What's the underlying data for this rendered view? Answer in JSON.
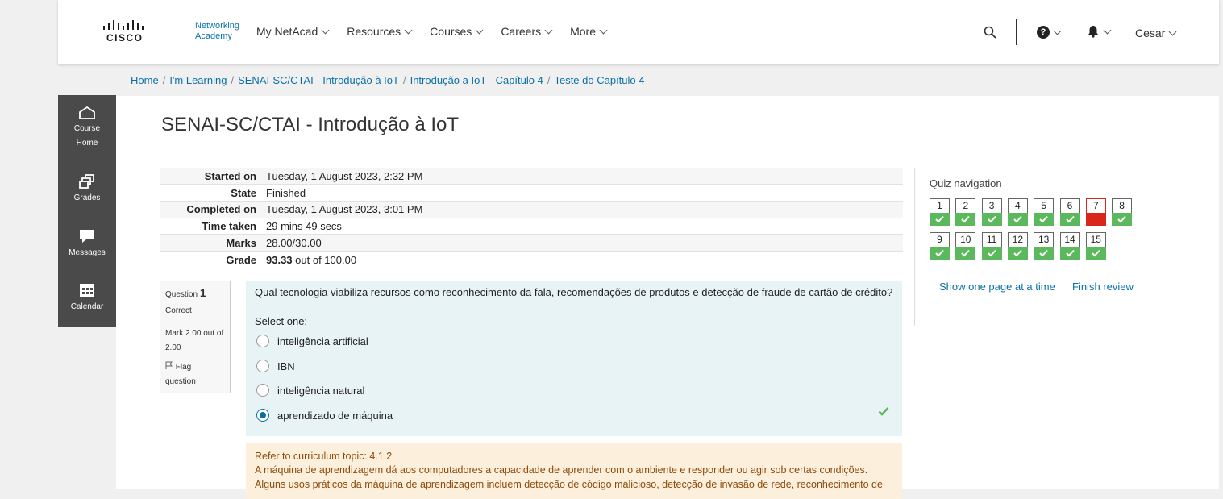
{
  "header": {
    "logo_word": "CISCO",
    "academy_line1": "Networking",
    "academy_line2": "Academy",
    "nav": [
      "My NetAcad",
      "Resources",
      "Courses",
      "Careers",
      "More"
    ],
    "help_glyph": "?",
    "user": "Cesar"
  },
  "breadcrumb": [
    "Home",
    "I'm Learning",
    "SENAI-SC/CTAI - Introdução à IoT",
    "Introdução a IoT - Capítulo 4",
    "Teste do Capítulo 4"
  ],
  "sidebar": [
    {
      "label1": "Course",
      "label2": "Home",
      "icon": "home-icon"
    },
    {
      "label1": "Grades",
      "label2": "",
      "icon": "grades-icon"
    },
    {
      "label1": "Messages",
      "label2": "",
      "icon": "messages-icon"
    },
    {
      "label1": "Calendar",
      "label2": "",
      "icon": "calendar-icon"
    }
  ],
  "page_title": "SENAI-SC/CTAI - Introdução à IoT",
  "summary": {
    "started_label": "Started on",
    "started": "Tuesday, 1 August 2023, 2:32 PM",
    "state_label": "State",
    "state": "Finished",
    "completed_label": "Completed on",
    "completed": "Tuesday, 1 August 2023, 3:01 PM",
    "time_label": "Time taken",
    "time": "29 mins 49 secs",
    "marks_label": "Marks",
    "marks": "28.00/30.00",
    "grade_label": "Grade",
    "grade_value": "93.33",
    "grade_rest": "out of 100.00"
  },
  "question": {
    "label": "Question",
    "number": "1",
    "status": "Correct",
    "mark_line1": "Mark 2.00 out of",
    "mark_line2": "2.00",
    "flag_line1": "Flag",
    "flag_line2": "question",
    "text": "Qual tecnologia viabiliza recursos como reconhecimento da fala, recomendações de produtos e detecção de fraude de cartão de crédito?",
    "select_one": "Select one:",
    "options": [
      "inteligência artificial",
      "IBN",
      "inteligência natural",
      "aprendizado de máquina"
    ],
    "selected_index": 3
  },
  "feedback": {
    "line1": "Refer to curriculum topic: 4.1.2",
    "line2": "A máquina de aprendizagem dá aos computadores a capacidade de aprender com o ambiente e responder ou agir sob certas condições.",
    "line3": "Alguns usos práticos da máquina de aprendizagem incluem detecção de código malicioso, detecção de invasão de rede, reconhecimento de"
  },
  "quiz_nav": {
    "title": "Quiz navigation",
    "questions": [
      {
        "n": "1",
        "state": "correct"
      },
      {
        "n": "2",
        "state": "correct"
      },
      {
        "n": "3",
        "state": "correct"
      },
      {
        "n": "4",
        "state": "correct"
      },
      {
        "n": "5",
        "state": "correct"
      },
      {
        "n": "6",
        "state": "correct"
      },
      {
        "n": "7",
        "state": "incorrect"
      },
      {
        "n": "8",
        "state": "correct"
      },
      {
        "n": "9",
        "state": "correct"
      },
      {
        "n": "10",
        "state": "correct"
      },
      {
        "n": "11",
        "state": "correct"
      },
      {
        "n": "12",
        "state": "correct"
      },
      {
        "n": "13",
        "state": "correct"
      },
      {
        "n": "14",
        "state": "correct"
      },
      {
        "n": "15",
        "state": "correct"
      }
    ],
    "show_one_page": "Show one page at a time",
    "finish_review": "Finish review"
  },
  "colors": {
    "link": "#0a6fa8",
    "correct": "#5cb85c",
    "incorrect": "#d9261c",
    "sidebar": "#4a4a4a"
  }
}
